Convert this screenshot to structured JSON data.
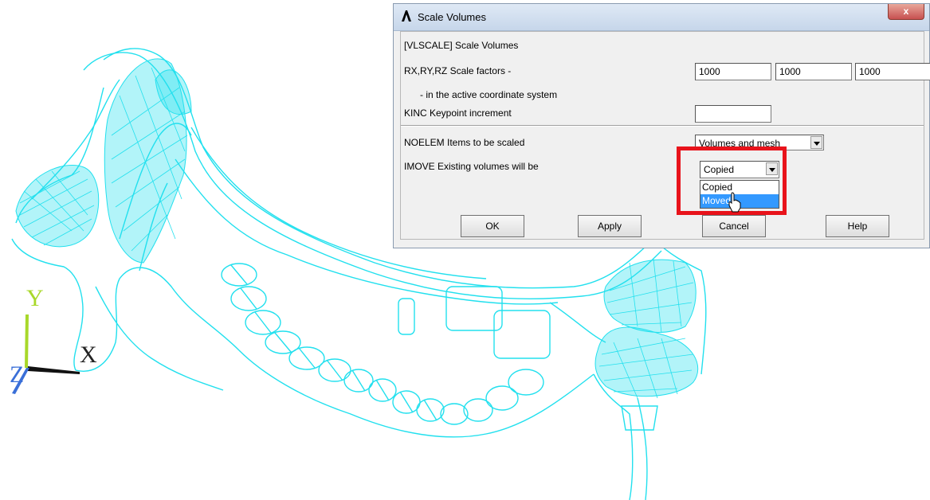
{
  "dialog": {
    "title": "Scale Volumes",
    "close_label": "x",
    "heading": "[VLSCALE]  Scale Volumes",
    "scale_factors": {
      "label": "RX,RY,RZ  Scale factors -",
      "sublabel": "- in the active coordinate system",
      "rx": "1000",
      "ry": "1000",
      "rz": "1000"
    },
    "kinc": {
      "label": "KINC   Keypoint increment",
      "value": ""
    },
    "noelem": {
      "label": "NOELEM  Items to be scaled",
      "value": "Volumes and mesh"
    },
    "imove": {
      "label": "IMOVE  Existing volumes will be",
      "value": "Copied",
      "options": [
        "Copied",
        "Moved"
      ],
      "highlighted": "Moved"
    },
    "buttons": {
      "ok": "OK",
      "apply": "Apply",
      "cancel": "Cancel",
      "help": "Help"
    }
  },
  "triad": {
    "x": "X",
    "y": "Y",
    "z": "Z"
  },
  "colors": {
    "wireframe": "#22e0ee",
    "highlight": "#e8131b",
    "selection": "#3399ff"
  }
}
